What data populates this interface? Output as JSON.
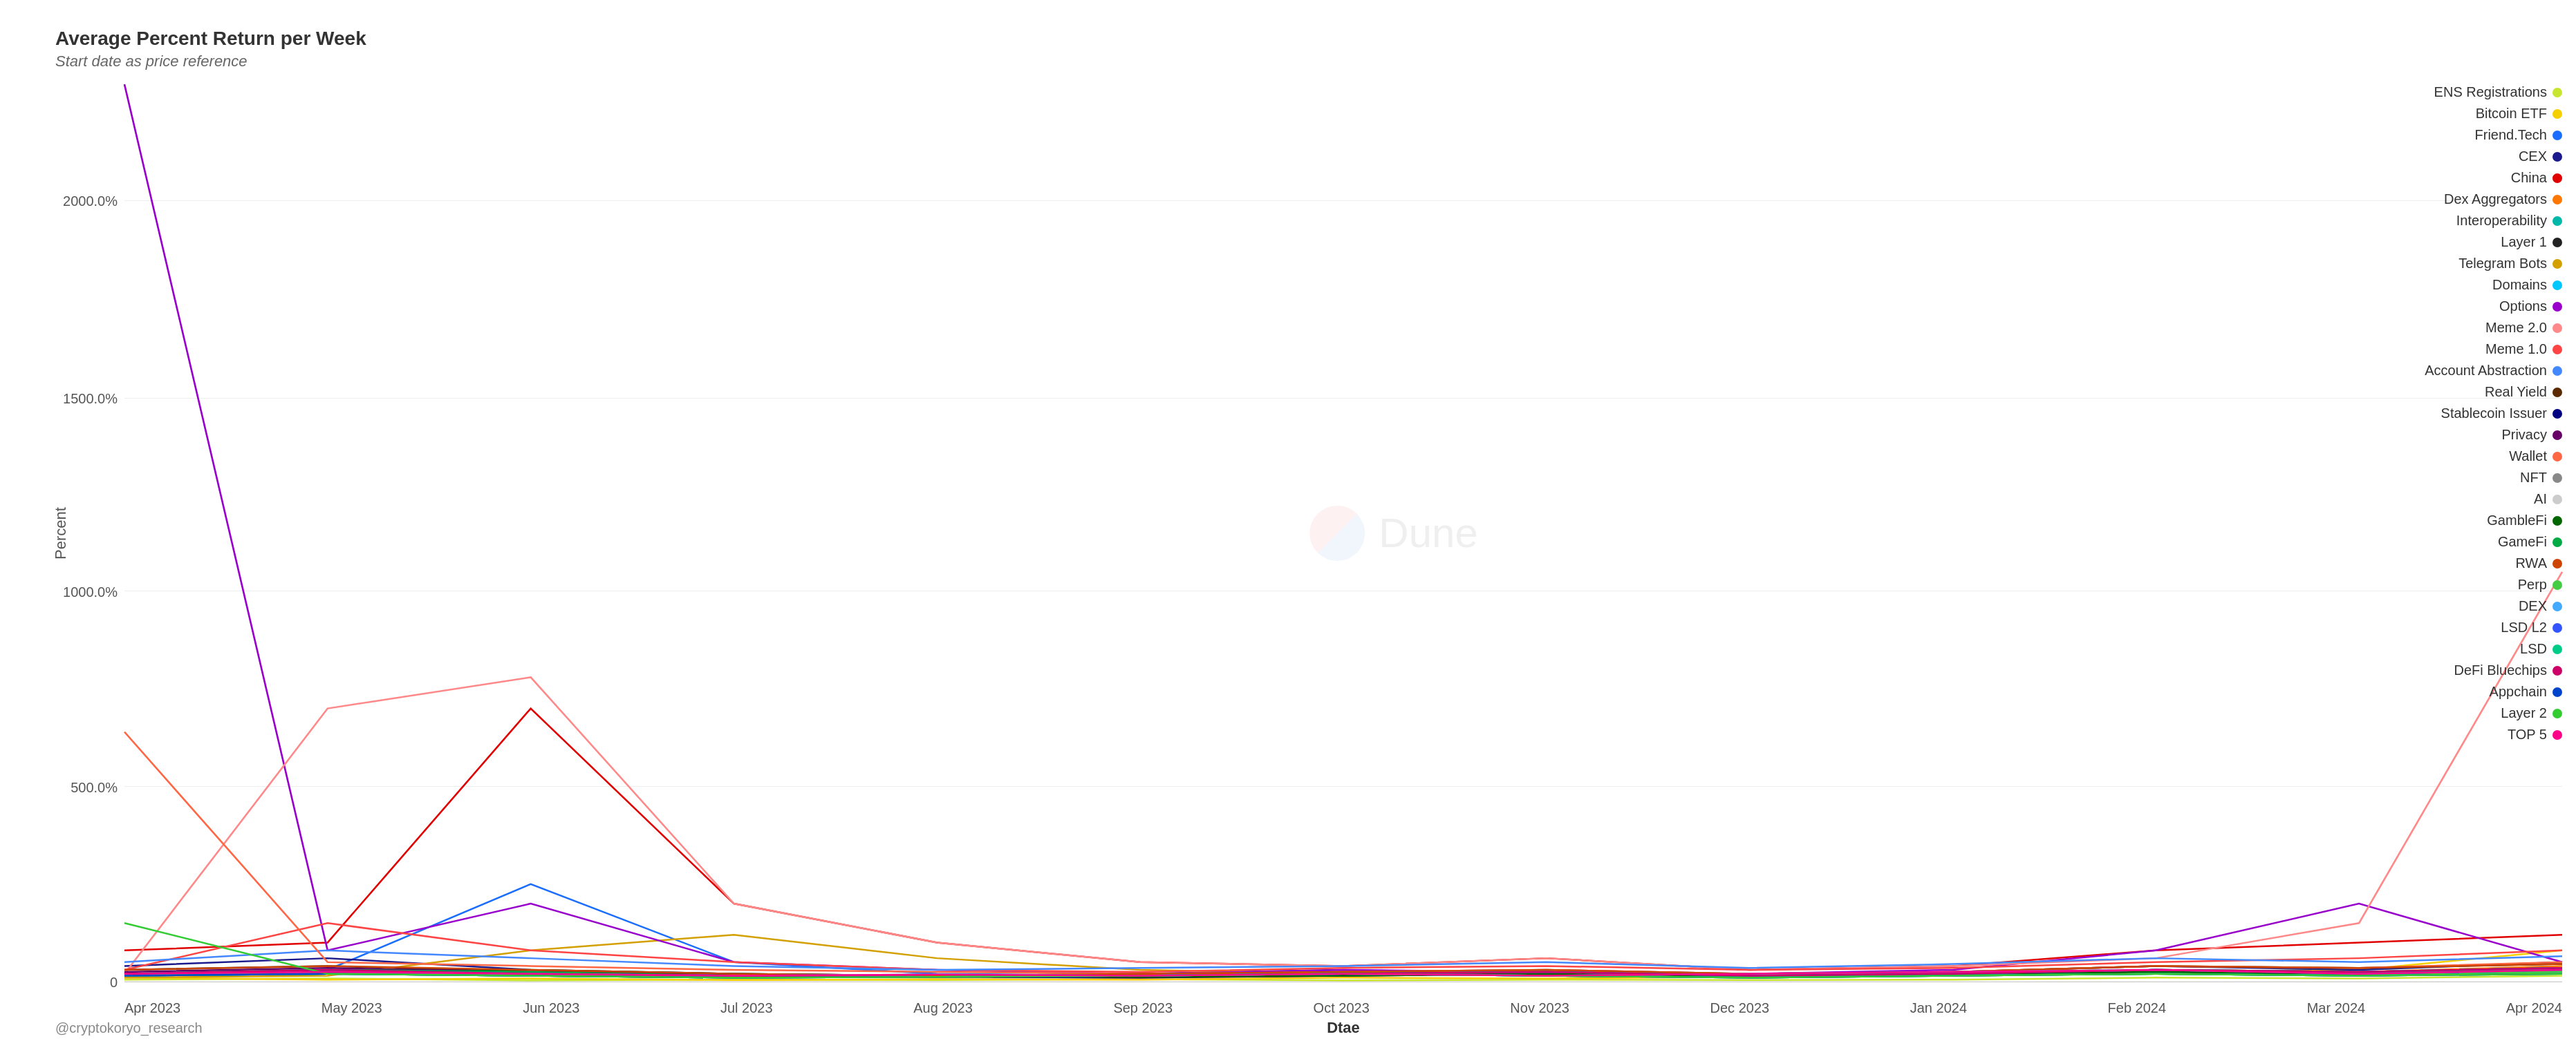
{
  "title": "Average Percent Return per Week",
  "subtitle": "Start date as price reference",
  "y_axis_label": "Percent",
  "x_axis_label": "Dtae",
  "footer_credit": "@cryptokoryo_research",
  "watermark_text": "Dune",
  "y_ticks": [
    {
      "label": "2000.0%",
      "pct": 0.87
    },
    {
      "label": "1500.0%",
      "pct": 0.65
    },
    {
      "label": "1000.0%",
      "pct": 0.435
    },
    {
      "label": "500.0%",
      "pct": 0.217
    },
    {
      "label": "0",
      "pct": 0.0
    }
  ],
  "x_ticks": [
    "Apr 2023",
    "May 2023",
    "Jun 2023",
    "Jul 2023",
    "Aug 2023",
    "Sep 2023",
    "Oct 2023",
    "Nov 2023",
    "Dec 2023",
    "Jan 2024",
    "Feb 2024",
    "Mar 2024",
    "Apr 2024"
  ],
  "legend": [
    {
      "label": "ENS Registrations",
      "color": "#c8e630"
    },
    {
      "label": "Bitcoin ETF",
      "color": "#f5d000"
    },
    {
      "label": "Friend.Tech",
      "color": "#1a6dff"
    },
    {
      "label": "CEX",
      "color": "#1a1a8c"
    },
    {
      "label": "China",
      "color": "#e00000"
    },
    {
      "label": "Dex Aggregators",
      "color": "#ff7700"
    },
    {
      "label": "Interoperability",
      "color": "#00b8a9"
    },
    {
      "label": "Layer 1",
      "color": "#222222"
    },
    {
      "label": "Telegram Bots",
      "color": "#d4a000"
    },
    {
      "label": "Domains",
      "color": "#00c8ff"
    },
    {
      "label": "Options",
      "color": "#9900cc"
    },
    {
      "label": "Meme 2.0",
      "color": "#ff8888"
    },
    {
      "label": "Meme 1.0",
      "color": "#ff4444"
    },
    {
      "label": "Account Abstraction",
      "color": "#4488ff"
    },
    {
      "label": "Real Yield",
      "color": "#5c2a00"
    },
    {
      "label": "Stablecoin Issuer",
      "color": "#000080"
    },
    {
      "label": "Privacy",
      "color": "#660066"
    },
    {
      "label": "Wallet",
      "color": "#ff6644"
    },
    {
      "label": "NFT",
      "color": "#888888"
    },
    {
      "label": "AI",
      "color": "#cccccc"
    },
    {
      "label": "GambleFi",
      "color": "#006600"
    },
    {
      "label": "GameFi",
      "color": "#00aa44"
    },
    {
      "label": "RWA",
      "color": "#cc4400"
    },
    {
      "label": "Perp",
      "color": "#44cc44"
    },
    {
      "label": "DEX",
      "color": "#44aaff"
    },
    {
      "label": "LSD L2",
      "color": "#3355ff"
    },
    {
      "label": "LSD",
      "color": "#00cc88"
    },
    {
      "label": "DeFi Bluechips",
      "color": "#cc0066"
    },
    {
      "label": "Appchain",
      "color": "#0044cc"
    },
    {
      "label": "Layer 2",
      "color": "#33cc33"
    },
    {
      "label": "TOP 5",
      "color": "#ff0088"
    }
  ]
}
